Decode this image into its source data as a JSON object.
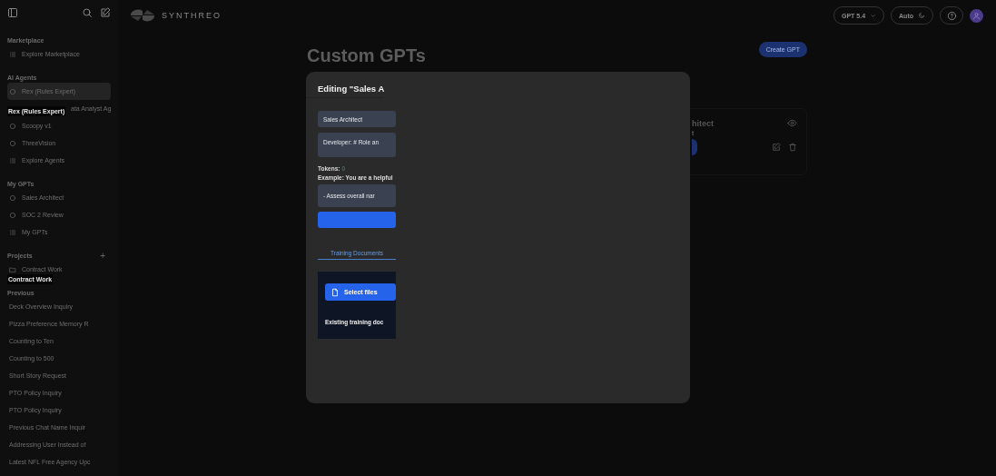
{
  "sidebar": {
    "sections": [
      {
        "title": "Marketplace",
        "items": [
          {
            "label": "Explore Marketplace",
            "kind": "list",
            "selected": false
          }
        ]
      },
      {
        "title": "AI Agents",
        "items": [
          {
            "label": "Rex (Rules Expert)",
            "kind": "agent",
            "selected": true
          },
          {
            "label": "ata Analyst Ag",
            "kind": "covered",
            "selected": false
          },
          {
            "label": "Scoopy v1",
            "kind": "agent",
            "selected": false
          },
          {
            "label": "ThreeVision",
            "kind": "agent",
            "selected": false
          },
          {
            "label": "Explore Agents",
            "kind": "list",
            "selected": false
          }
        ]
      },
      {
        "title": "My GPTs",
        "items": [
          {
            "label": "Sales Architect",
            "kind": "agent",
            "selected": false
          },
          {
            "label": "SOC 2 Review",
            "kind": "agent",
            "selected": false
          },
          {
            "label": "My GPTs",
            "kind": "list",
            "selected": false
          }
        ]
      },
      {
        "title": "Projects",
        "add": "+",
        "items": [
          {
            "label": "Contract Work",
            "kind": "folder",
            "selected": false
          }
        ]
      },
      {
        "title": "Previous",
        "items": [
          {
            "label": "Deck Overview Inquiry",
            "kind": "chat",
            "selected": false
          },
          {
            "label": "Pizza Preference Memory R",
            "kind": "chat",
            "selected": false
          },
          {
            "label": "Counting to Ten",
            "kind": "chat",
            "selected": false
          },
          {
            "label": "Counting to 500",
            "kind": "chat",
            "selected": false
          },
          {
            "label": "Short Story Request",
            "kind": "chat",
            "selected": false
          },
          {
            "label": "PTO Policy Inquiry",
            "kind": "chat",
            "selected": false
          },
          {
            "label": "PTO Policy Inquiry",
            "kind": "chat",
            "selected": false
          },
          {
            "label": "Previous Chat Name Inquir",
            "kind": "chat",
            "selected": false
          },
          {
            "label": "Addressing User Instead of",
            "kind": "chat",
            "selected": false
          },
          {
            "label": "Latest NFL Free Agency Upc",
            "kind": "chat",
            "selected": false
          }
        ]
      }
    ],
    "tooltips": [
      "Rex (Rules Expert)",
      "Contract Work"
    ]
  },
  "topbar": {
    "logo": "SYNTHREO",
    "model": "GPT 5.4",
    "theme": "Auto"
  },
  "page": {
    "title": "Custom GPTs",
    "create_button": "Create GPT",
    "card": {
      "title": "hitect",
      "subtitle": "t"
    }
  },
  "dialog": {
    "title": "Editing \"Sales A",
    "name_value": "Sales Architect",
    "instructions_value": "Developer: # Role an",
    "tokens_label": "Tokens:",
    "tokens_value": "0",
    "example": "Example: You are a helpful",
    "textarea_value": "- Assess overall nar",
    "tabs": [
      {
        "label": "Training Documents",
        "selected": true
      }
    ],
    "select_files": "Select files",
    "existing": "Existing training doc"
  }
}
